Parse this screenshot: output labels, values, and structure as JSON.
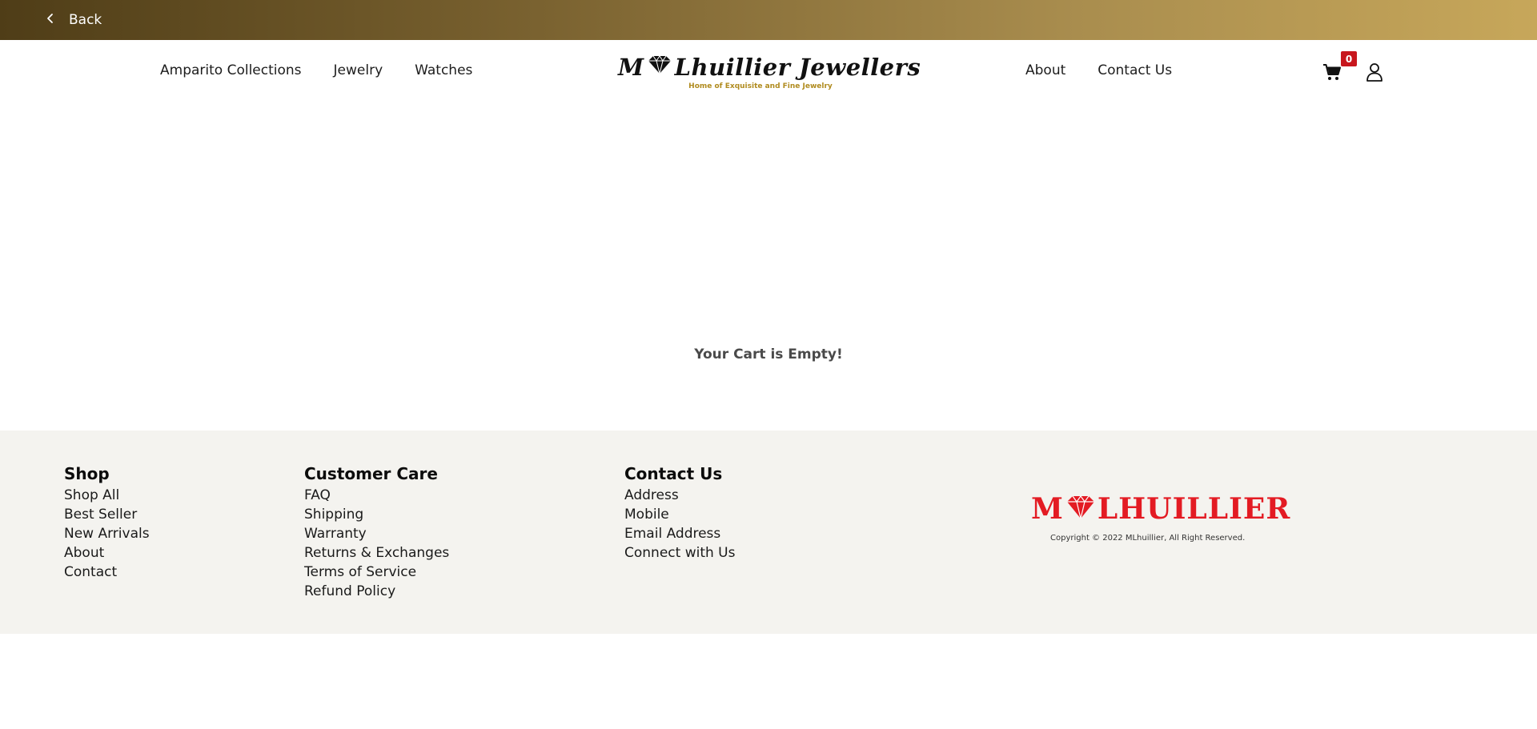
{
  "topbar": {
    "back_label": "Back"
  },
  "nav": {
    "left": [
      {
        "label": "Amparito Collections"
      },
      {
        "label": "Jewelry"
      },
      {
        "label": "Watches"
      }
    ],
    "right": [
      {
        "label": "About"
      },
      {
        "label": "Contact Us"
      }
    ]
  },
  "logo": {
    "wordmark_prefix": "M",
    "wordmark_suffix": "Lhuillier Jewellers",
    "tagline": "Home of Exquisite and Fine Jewelry"
  },
  "cart": {
    "count": "0",
    "icon": "cart-icon"
  },
  "account": {
    "icon": "user-icon"
  },
  "main": {
    "empty_message": "Your Cart is Empty!"
  },
  "footer": {
    "shop": {
      "heading": "Shop",
      "links": [
        "Shop All",
        "Best Seller",
        "New Arrivals",
        "About",
        "Contact"
      ]
    },
    "care": {
      "heading": "Customer Care",
      "links": [
        "FAQ",
        "Shipping",
        "Warranty",
        "Returns & Exchanges",
        "Terms of Service",
        "Refund Policy"
      ]
    },
    "contact": {
      "heading": "Contact Us",
      "links": [
        "Address",
        "Mobile",
        "Email Address",
        "Connect with Us"
      ]
    },
    "brand": {
      "wordmark_prefix": "M",
      "wordmark_suffix": "LHUILLIER",
      "copyright": "Copyright © 2022 MLhuillier, All Right Reserved."
    }
  },
  "colors": {
    "gold_dark": "#4f3d17",
    "gold_light": "#c7a75a",
    "badge_red": "#c8161d",
    "brand_red": "#e31b23",
    "footer_bg": "#f4f3ef"
  }
}
